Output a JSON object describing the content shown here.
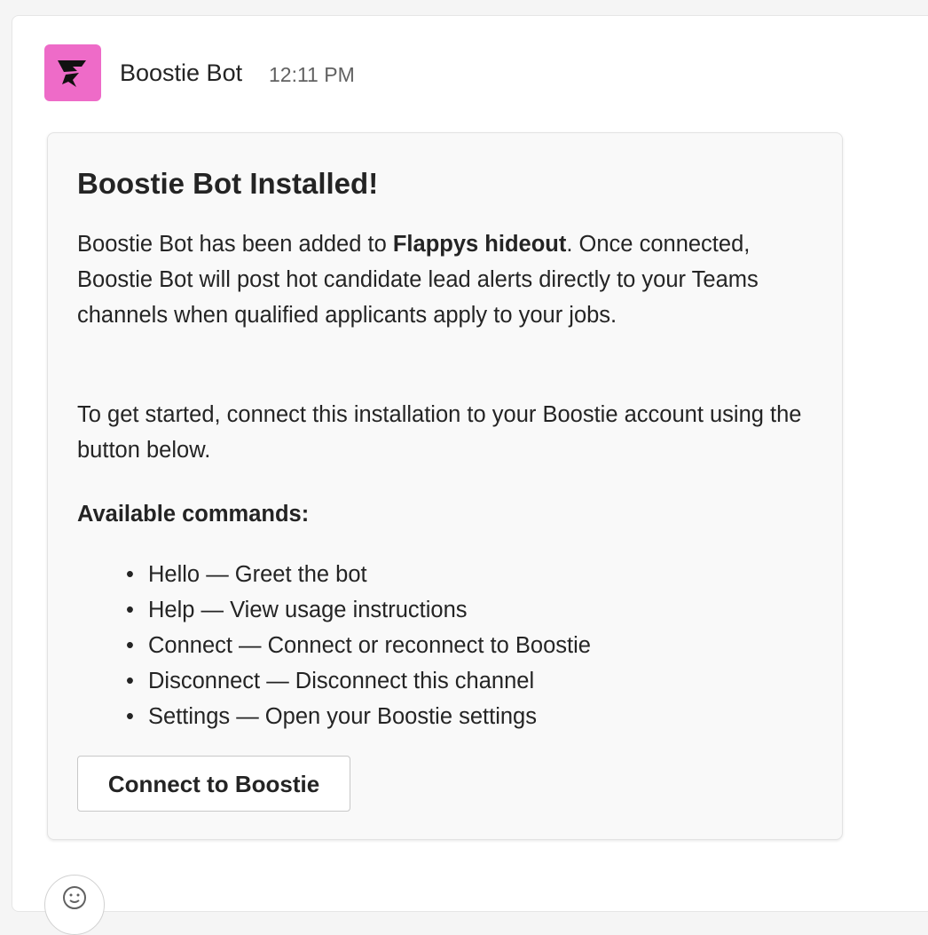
{
  "message": {
    "sender": "Boostie Bot",
    "timestamp": "12:11 PM",
    "avatar_icon": "boostie-logo-icon",
    "avatar_color": "#ee6bc8"
  },
  "card": {
    "title": "Boostie Bot Installed!",
    "intro_before": "Boostie Bot has been added to ",
    "intro_bold": "Flappys hideout",
    "intro_after": ". Once connected, Boostie Bot will post hot candidate lead alerts directly to your Teams channels when qualified applicants apply to your jobs.",
    "instructions": "To get started, connect this installation to your Boostie account using the button below.",
    "commands_heading": "Available commands:",
    "commands": [
      "Hello — Greet the bot",
      "Help — View usage instructions",
      "Connect — Connect or reconnect to Boostie",
      "Disconnect — Disconnect this channel",
      "Settings — Open your Boostie settings"
    ],
    "bullet": "•",
    "button_label": "Connect to Boostie"
  },
  "reaction": {
    "icon": "emoji-smile-icon"
  }
}
